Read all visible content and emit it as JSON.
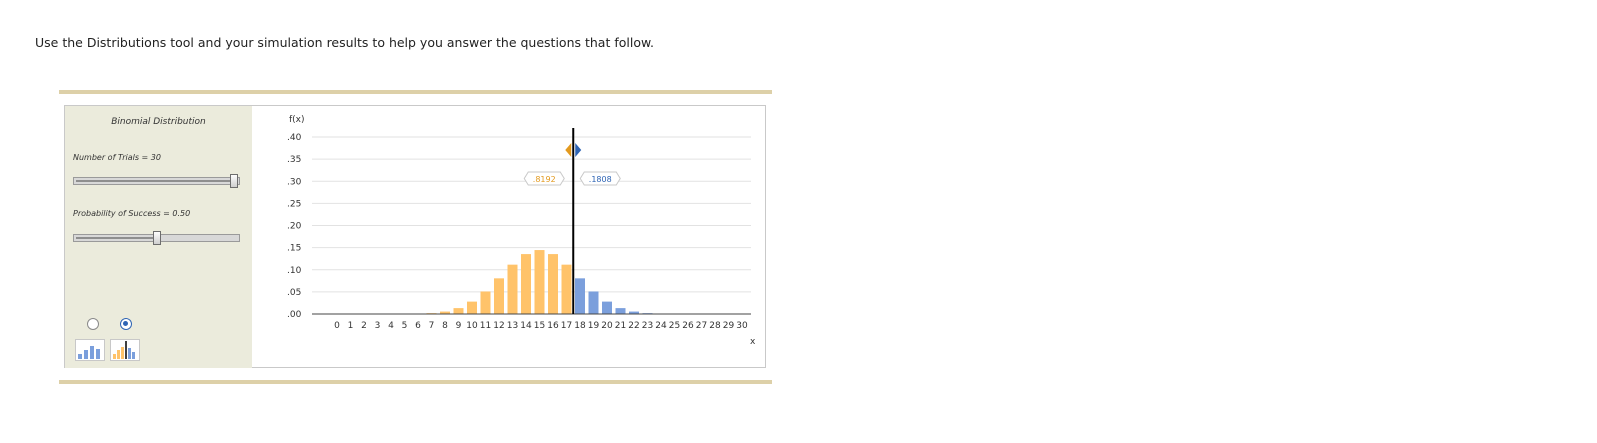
{
  "intro_text": "Use the Distributions tool and your simulation results to help you answer the questions that follow.",
  "panel": {
    "title": "Binomial Distribution",
    "trials_label": "Number of Trials = 30",
    "probability_label": "Probability of Success = 0.50",
    "trials_level": 1.0,
    "probability_level": 0.5,
    "mode_selected": "cumulative-split"
  },
  "colors": {
    "left_bars": "#ffc36a",
    "right_bars": "#7b9fdc",
    "left_value": "#e39a1f",
    "right_value": "#2e64b4",
    "panel_bg": "#ebebdc"
  },
  "icons": {
    "mode_1": "bar-chart-icon",
    "mode_2": "split-bar-chart-icon",
    "left_arrow": "left-triangle-handle-icon",
    "right_arrow": "right-triangle-handle-icon"
  },
  "chart_data": {
    "type": "bar",
    "ylabel": "f(x)",
    "xlabel": "x",
    "ylim": [
      0,
      0.4
    ],
    "yticks": [
      ".00",
      ".05",
      ".10",
      ".15",
      ".20",
      ".25",
      ".30",
      ".35",
      ".40"
    ],
    "categories": [
      "0",
      "1",
      "2",
      "3",
      "4",
      "5",
      "6",
      "7",
      "8",
      "9",
      "10",
      "11",
      "12",
      "13",
      "14",
      "15",
      "16",
      "17",
      "18",
      "19",
      "20",
      "21",
      "22",
      "23",
      "24",
      "25",
      "26",
      "27",
      "28",
      "29",
      "30"
    ],
    "values": [
      0.0,
      0.0,
      0.0,
      0.0,
      0.0,
      0.0001,
      0.0006,
      0.0019,
      0.0055,
      0.0133,
      0.028,
      0.0509,
      0.0806,
      0.1115,
      0.1354,
      0.1445,
      0.1354,
      0.1115,
      0.0806,
      0.0509,
      0.028,
      0.0133,
      0.0055,
      0.0019,
      0.0006,
      0.0001,
      0.0,
      0.0,
      0.0,
      0.0,
      0.0
    ],
    "cutoff": 17.5,
    "left_area_label": ".8192",
    "right_area_label": ".1808",
    "grid": true
  }
}
